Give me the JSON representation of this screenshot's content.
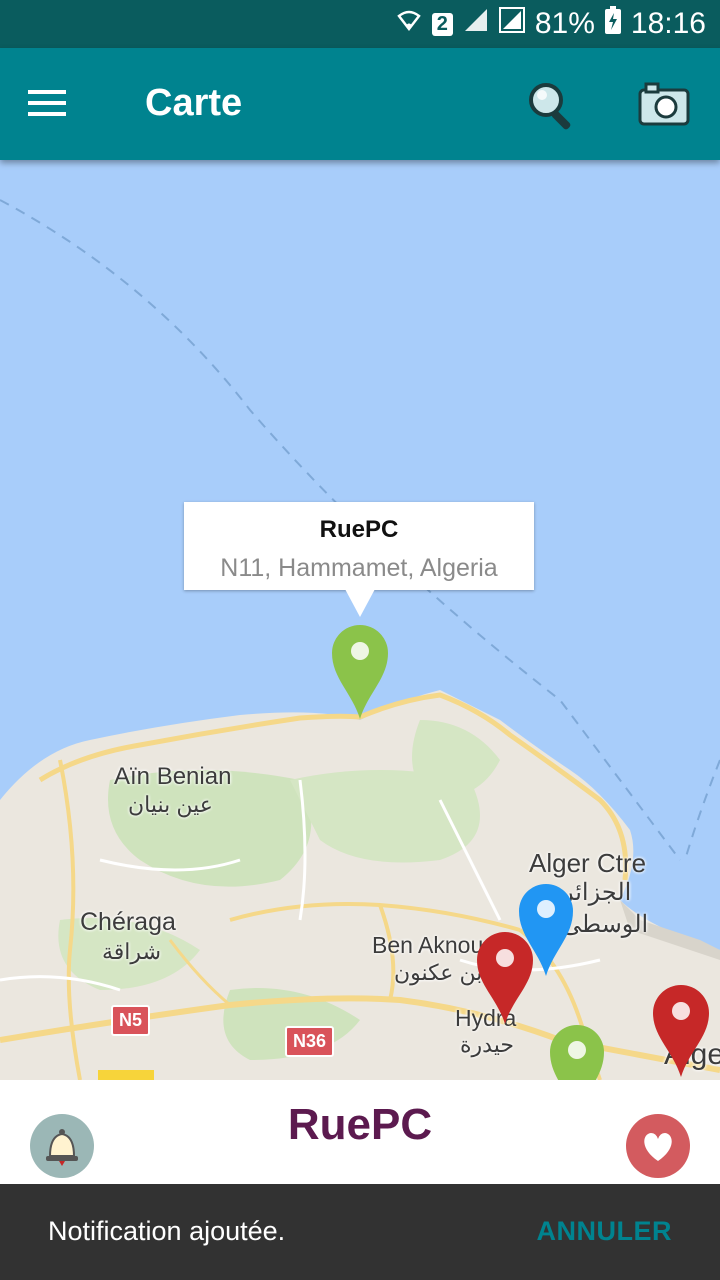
{
  "status_bar": {
    "sim_badge": "2",
    "battery": "81%",
    "time": "18:16"
  },
  "app_bar": {
    "title": "Carte",
    "menu_icon": "menu-icon",
    "search_icon": "search-icon",
    "camera_icon": "camera-icon"
  },
  "map": {
    "callout": {
      "title": "RuePC",
      "subtitle": "N11, Hammamet, Algeria"
    },
    "labels": {
      "ain_benian": "Aïn Benian",
      "ain_benian_ar": "عين بنيان",
      "cheraga": "Chéraga",
      "cheraga_ar": "شراقة",
      "ben_aknoun": "Ben Aknou",
      "ben_aknoun_ar": "بن عكنون",
      "hydra": "Hydra",
      "hydra_ar": "حيدرة",
      "alger_ctre": "Alger Ctre",
      "alger_ctre_ar1": "الجزائر",
      "alger_ctre_ar2": "الوسطى",
      "alger": "Alge"
    },
    "road_shields": {
      "n5": "N5",
      "n36": "N36"
    },
    "marker_colors": {
      "selected": "#8bc34a",
      "red": "#c62828",
      "blue": "#2196f3",
      "green": "#8bc34a"
    }
  },
  "bottom_sheet": {
    "name": "RuePC",
    "bell_icon": "bell-icon",
    "heart_icon": "heart-icon"
  },
  "snackbar": {
    "message": "Notification ajoutée.",
    "action": "ANNULER"
  }
}
